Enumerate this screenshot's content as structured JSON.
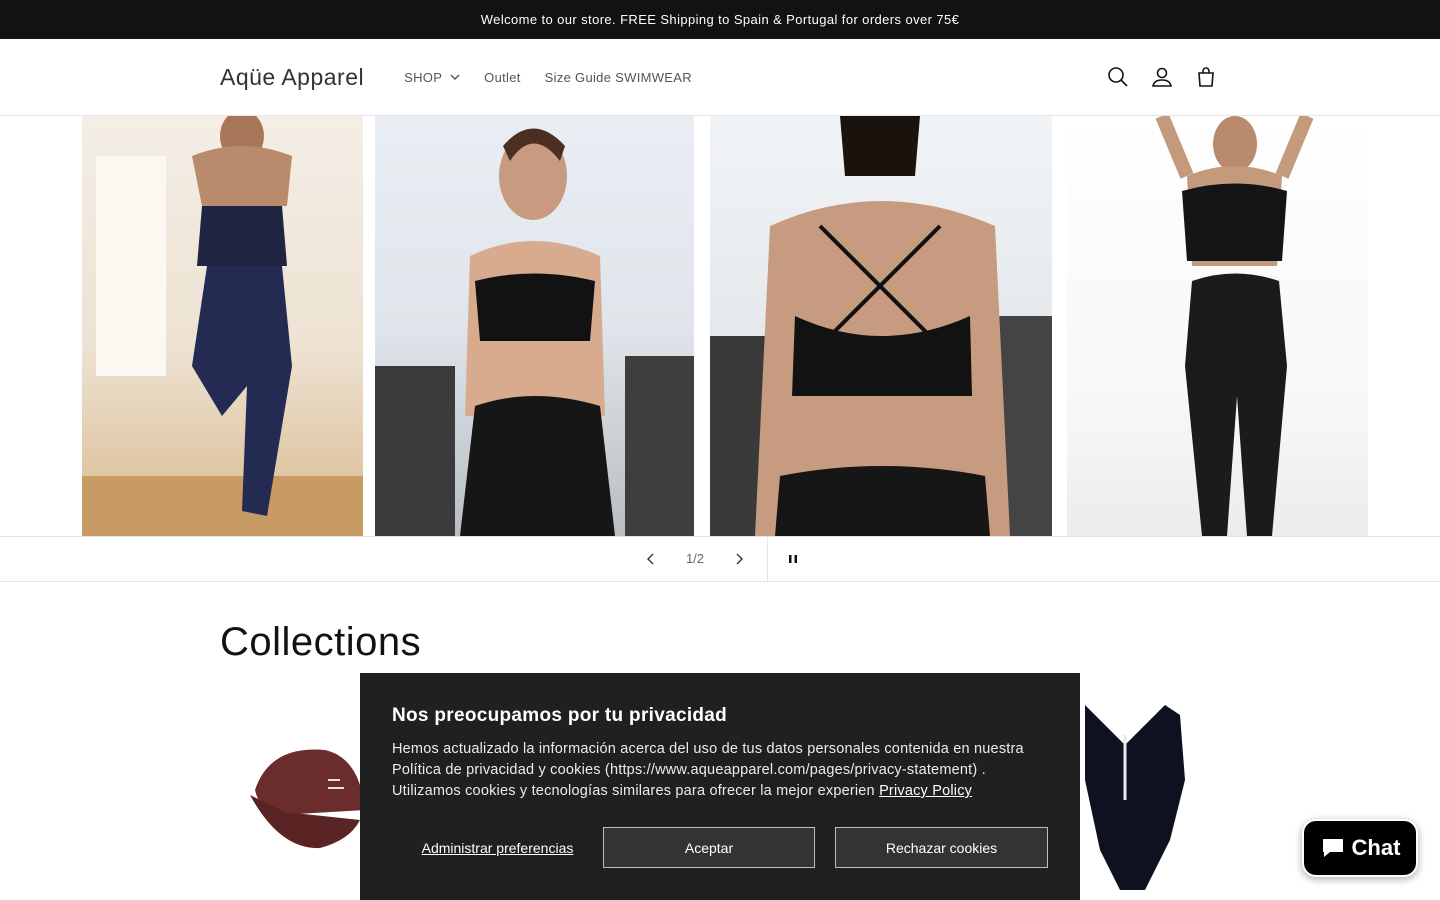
{
  "announcement": {
    "text": "Welcome to our store. FREE Shipping to Spain & Portugal for orders over 75€"
  },
  "header": {
    "logo": "Aqüe Apparel",
    "nav": [
      {
        "label": "SHOP",
        "dropdown": true
      },
      {
        "label": "Outlet"
      },
      {
        "label": "Size Guide SWIMWEAR"
      }
    ],
    "icons": [
      "search-icon",
      "account-icon",
      "cart-icon"
    ]
  },
  "slideshow": {
    "counter": "1/2",
    "slides": [
      "navy sports bra and leggings, back view, dance studio",
      "black sports bra and leggings, front view, gym",
      "black cross-back sports bra, back view, gym",
      "black crop top and leggings, front view, white background"
    ]
  },
  "collections": {
    "title": "Collections"
  },
  "cookie_banner": {
    "title": "Nos preocupamos por tu privacidad",
    "body": "Hemos actualizado la información acerca del uso de tus datos personales contenida en nuestra Política de privacidad y cookies (https://www.aqueapparel.com/pages/privacy-statement) . Utilizamos cookies y tecnologías similares para ofrecer la mejor experien",
    "privacy_link": "Privacy Policy",
    "manage_label": "Administrar preferencias",
    "accept_label": "Aceptar",
    "reject_label": "Rechazar cookies"
  },
  "chat": {
    "label": "Chat"
  },
  "colors": {
    "dark": "#121212",
    "banner_bg": "#202020",
    "button_bg": "#333333"
  }
}
